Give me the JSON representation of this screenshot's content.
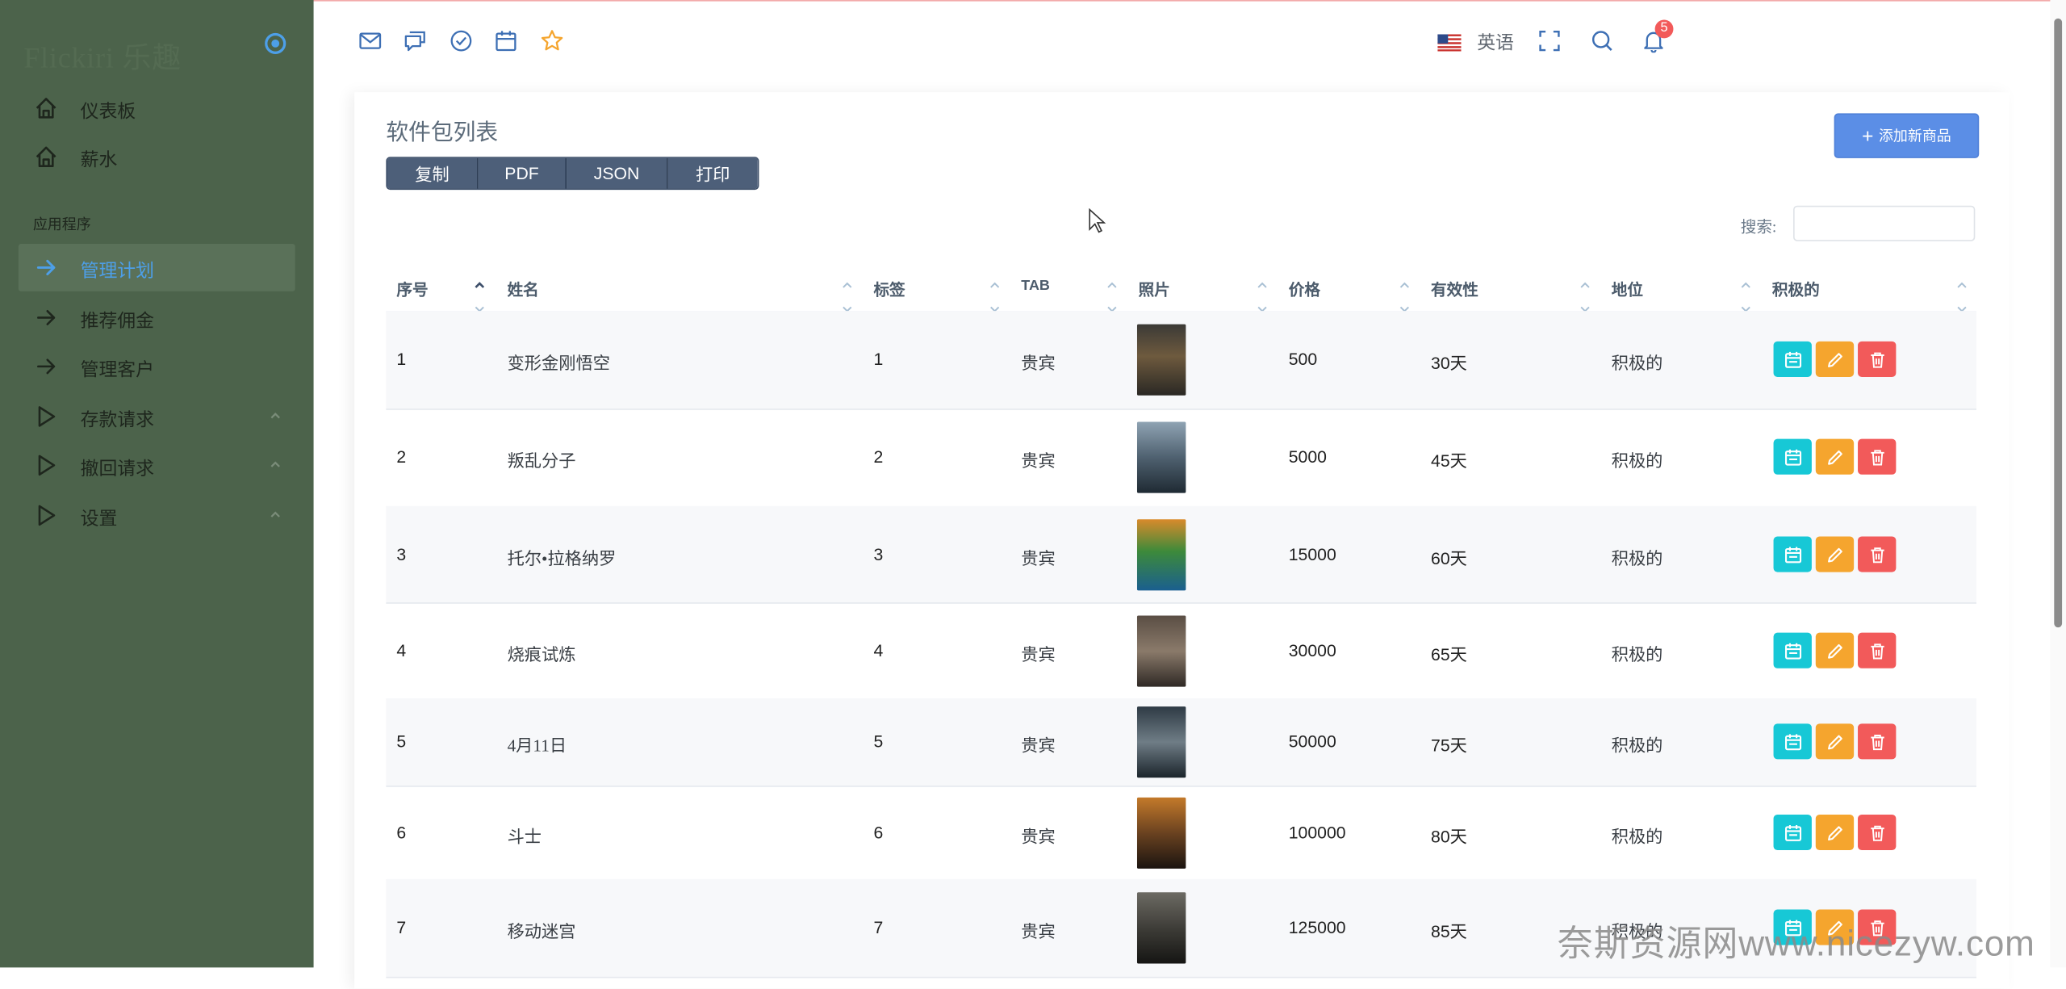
{
  "app": {
    "brand": "Flickiri 乐趣"
  },
  "sidebar": {
    "section_label": "应用程序",
    "items": [
      {
        "label": "仪表板",
        "icon": "home-icon"
      },
      {
        "label": "薪水",
        "icon": "home-icon"
      },
      {
        "label": "管理计划",
        "icon": "arrow-right-icon",
        "active": true
      },
      {
        "label": "推荐佣金",
        "icon": "arrow-right-icon"
      },
      {
        "label": "管理客户",
        "icon": "arrow-right-icon"
      },
      {
        "label": "存款请求",
        "icon": "play-icon",
        "expandable": true
      },
      {
        "label": "撤回请求",
        "icon": "play-icon",
        "expandable": true
      },
      {
        "label": "设置",
        "icon": "play-icon",
        "expandable": true
      }
    ]
  },
  "topbar": {
    "icons": [
      "mail-icon",
      "chat-icon",
      "check-circle-icon",
      "calendar-icon",
      "star-icon"
    ],
    "language": "英语",
    "notification_count": "5"
  },
  "page": {
    "title": "软件包列表",
    "export_buttons": [
      "复制",
      "PDF",
      "JSON",
      "打印"
    ],
    "add_button": "添加新商品",
    "search_label": "搜索:",
    "search_value": ""
  },
  "table": {
    "columns": [
      "序号",
      "姓名",
      "标签",
      "TAB",
      "照片",
      "价格",
      "有效性",
      "地位",
      "积极的"
    ],
    "rows": [
      {
        "no": "1",
        "name": "变形金刚悟空",
        "tag": "1",
        "tab": "贵宾",
        "price": "500",
        "validity": "30天",
        "status": "积极的"
      },
      {
        "no": "2",
        "name": "叛乱分子",
        "tag": "2",
        "tab": "贵宾",
        "price": "5000",
        "validity": "45天",
        "status": "积极的"
      },
      {
        "no": "3",
        "name": "托尔•拉格纳罗",
        "tag": "3",
        "tab": "贵宾",
        "price": "15000",
        "validity": "60天",
        "status": "积极的"
      },
      {
        "no": "4",
        "name": "烧痕试炼",
        "tag": "4",
        "tab": "贵宾",
        "price": "30000",
        "validity": "65天",
        "status": "积极的"
      },
      {
        "no": "5",
        "name": "4月11日",
        "tag": "5",
        "tab": "贵宾",
        "price": "50000",
        "validity": "75天",
        "status": "积极的"
      },
      {
        "no": "6",
        "name": "斗士",
        "tag": "6",
        "tab": "贵宾",
        "price": "100000",
        "validity": "80天",
        "status": "积极的"
      },
      {
        "no": "7",
        "name": "移动迷宫",
        "tag": "7",
        "tab": "贵宾",
        "price": "125000",
        "validity": "85天",
        "status": "积极的"
      }
    ]
  },
  "watermark": "奈斯资源网www.nicezyw.com",
  "colors": {
    "sidebar": "#4c634b",
    "active": "#4d9fe8",
    "primary": "#5b8ee6",
    "info": "#17c8d6",
    "warning": "#f5a52e",
    "danger": "#f25a5a"
  }
}
